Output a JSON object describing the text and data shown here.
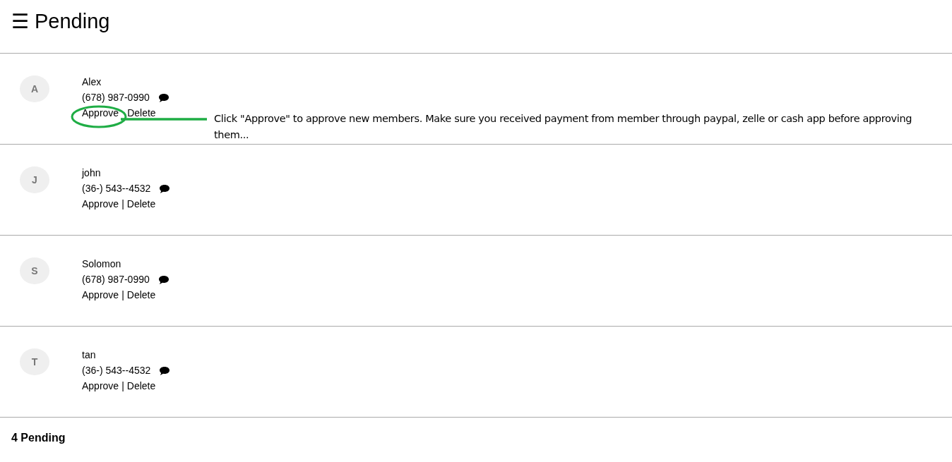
{
  "header": {
    "menu_icon": "☰",
    "title": "Pending"
  },
  "members": [
    {
      "initial": "A",
      "name": "Alex",
      "phone": "(678) 987-0990",
      "actions": [
        "Approve",
        "Delete"
      ],
      "callout": "Click \"Approve\" to approve new members. Make sure you received payment from member through paypal, zelle or cash app before approving them..."
    },
    {
      "initial": "J",
      "name": "john",
      "phone": "(36-) 543--4532",
      "actions": [
        "Approve",
        "Delete"
      ],
      "separator": "|"
    },
    {
      "initial": "S",
      "name": "Solomon",
      "phone": "(678) 987-0990",
      "actions": [
        "Approve",
        "Delete"
      ],
      "separator": "|"
    },
    {
      "initial": "T",
      "name": "tan",
      "phone": "(36-) 543--4532",
      "actions": [
        "Approve",
        "Delete"
      ],
      "separator": "|"
    }
  ],
  "footer": {
    "count": "4 Pending"
  }
}
